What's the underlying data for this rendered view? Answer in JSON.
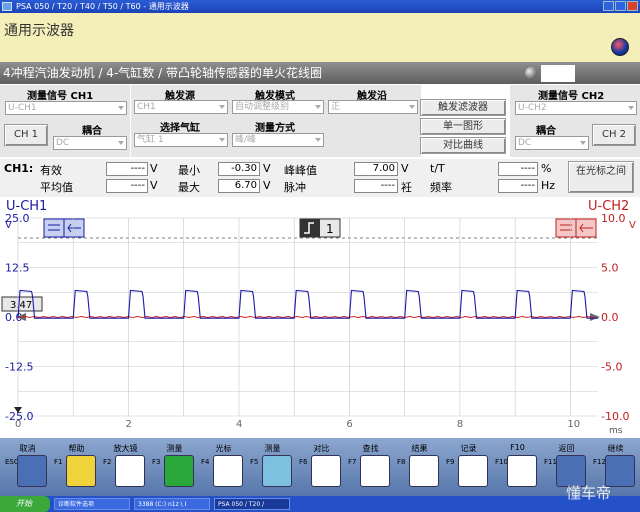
{
  "window": {
    "title": "PSA 050 / T20 / T40 / T50 / T60 - 通用示波器"
  },
  "header": {
    "title": "通用示波器"
  },
  "subbar": {
    "text": "4冲程汽油发动机 /  4-气缸数 / 带凸轮轴传感器的单火花线圈"
  },
  "left_panel": {
    "heading": "测量信号 CH1",
    "signal": "U-CH1",
    "ch_button": "CH 1",
    "coupling_label": "耦合",
    "coupling": "DC"
  },
  "right_panel": {
    "heading": "测量信号 CH2",
    "signal": "U-CH2",
    "ch_button": "CH 2",
    "coupling_label": "耦合",
    "coupling": "DC"
  },
  "trigger": {
    "source_label": "触发源",
    "source": "CH1",
    "mode_label": "触发模式",
    "mode": "自动调整级别",
    "edge_label": "触发沿",
    "edge": "正",
    "cyl_label": "选择气缸",
    "cyl": "气缸 1",
    "method_label": "测量方式",
    "method": "峰/峰"
  },
  "buttons": {
    "filter": "触发滤波器",
    "single": "单一图形",
    "compare": "对比曲线"
  },
  "measurements": {
    "ch": "CH1:",
    "eff_label": "有效",
    "eff_val": "----",
    "eff_unit": "V",
    "avg_label": "平均值",
    "avg_val": "----",
    "avg_unit": "V",
    "min_label": "最小",
    "min_val": "-0.30",
    "min_unit": "V",
    "max_label": "最大",
    "max_val": "6.70",
    "max_unit": "V",
    "pp_label": "峰峰值",
    "pp_val": "7.00",
    "pp_unit": "V",
    "pulse_label": "脉冲",
    "pulse_val": "----",
    "pulse_unit": "衽",
    "tt_label": "t/T",
    "tt_val": "----",
    "tt_unit": "%",
    "freq_label": "频率",
    "freq_val": "----",
    "freq_unit": "Hz",
    "cursor_btn": "在光标之间"
  },
  "chart_data": {
    "type": "line",
    "ch1_label": "U-CH1",
    "ch2_label": "U-CH2",
    "ch1_unit": "V",
    "ch2_unit": "V",
    "x_unit": "ms",
    "y1_ticks": [
      "25.0",
      "12.5",
      "0.0",
      "-12.5",
      "-25.0"
    ],
    "y2_ticks": [
      "10.0",
      "5.0",
      "0.0",
      "-5.0",
      "-10.0"
    ],
    "x_ticks": [
      "0",
      "2",
      "4",
      "6",
      "8",
      "10"
    ],
    "y1lim": [
      -25,
      25
    ],
    "y2lim": [
      -10,
      10
    ],
    "xlim": [
      0,
      10.5
    ],
    "ch1_marker": "3.47",
    "trigger_label": "1",
    "series": [
      {
        "name": "U-CH1",
        "color": "#1a1aa8",
        "pulse_high": 6.7,
        "baseline": -0.3,
        "period_ms": 1.0,
        "pulse_width_ms": 0.3,
        "first_pulse_ms": 0.0
      },
      {
        "name": "U-CH2",
        "color": "#d02020",
        "level": 0.0
      }
    ],
    "grid": true
  },
  "fkeys": [
    {
      "name": "取消",
      "key": "ESC",
      "color": "#4a6fb5",
      "icon": "chevron-up-icon"
    },
    {
      "name": "帮助",
      "key": "F1",
      "color": "#f0d23a",
      "icon": "question-icon"
    },
    {
      "name": "放大镜",
      "key": "F2",
      "color": "#ffffff",
      "icon": "magnifier-icon"
    },
    {
      "name": "测量",
      "key": "F3",
      "color": "#2aa83a",
      "icon": "play-icon"
    },
    {
      "name": "光标",
      "key": "F4",
      "color": "#ffffff",
      "icon": "cursor-wave-icon"
    },
    {
      "name": "测量",
      "key": "F5",
      "color": "#7ec0e0",
      "icon": "measure-device-icon"
    },
    {
      "name": "对比",
      "key": "F6",
      "color": "#ffffff",
      "icon": "compare-wave-icon"
    },
    {
      "name": "查找",
      "key": "F7",
      "color": "#ffffff",
      "icon": "binoculars-icon"
    },
    {
      "name": "结果",
      "key": "F8",
      "color": "#ffffff",
      "icon": "result-printer-icon"
    },
    {
      "name": "记录",
      "key": "F9",
      "color": "#ffffff",
      "icon": "document-icon"
    },
    {
      "name": "F10",
      "key": "F10",
      "color": "#ffffff",
      "icon": "tree-icon"
    },
    {
      "name": "返回",
      "key": "F11",
      "color": "#4a6fb5",
      "icon": "back-icon"
    },
    {
      "name": "继续",
      "key": "F12",
      "color": "#4a6fb5",
      "icon": "forward-icon"
    }
  ],
  "taskbar": {
    "start": "开始",
    "tasks": [
      "诊断软件选项",
      "3388 (C:) n1z \\ I",
      "PSA 050 / T20 /"
    ]
  },
  "watermark": "懂车帝"
}
